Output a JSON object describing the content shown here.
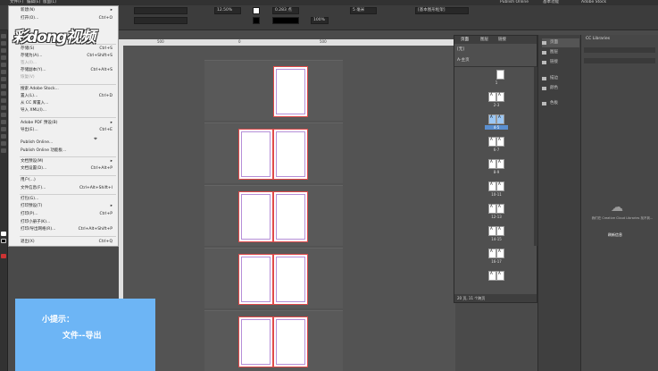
{
  "menubar": {
    "items": [
      "文件(F)",
      "编辑(E)",
      "版面(L)"
    ],
    "right": [
      "Publish Online",
      "基本功能",
      "Adobe Stock"
    ]
  },
  "control": {
    "zoom": "12.50%",
    "stroke_weight": "0.283 点",
    "opacity": "100%",
    "columns": "5 毫米",
    "style": "[基本图形框架]"
  },
  "file_menu": {
    "items": [
      {
        "label": "新建(N)",
        "shortcut": ""
      },
      {
        "label": "打开(O)...",
        "shortcut": "Ctrl+O"
      },
      {
        "label": "存储(S)",
        "shortcut": "Ctrl+S"
      },
      {
        "label": "存储为(A)...",
        "shortcut": "Ctrl+Shift+S"
      },
      {
        "label": "签入(I)...",
        "shortcut": ""
      },
      {
        "label": "存储副本(Y)...",
        "shortcut": "Ctrl+Alt+S"
      },
      {
        "label": "恢复(V)",
        "shortcut": ""
      },
      {
        "label": "搜索 Adobe Stock...",
        "shortcut": ""
      },
      {
        "label": "置入(L)...",
        "shortcut": "Ctrl+D"
      },
      {
        "label": "从 CC 库置入...",
        "shortcut": ""
      },
      {
        "label": "导入 XML(I)...",
        "shortcut": ""
      },
      {
        "label": "Adobe PDF 预设(B)",
        "shortcut": ""
      },
      {
        "label": "导出(E)...",
        "shortcut": "Ctrl+E"
      },
      {
        "label": "Publish Online...",
        "shortcut": ""
      },
      {
        "label": "Publish Online 功能板...",
        "shortcut": ""
      },
      {
        "label": "文档预设(M)",
        "shortcut": ""
      },
      {
        "label": "文档设置(D)...",
        "shortcut": "Ctrl+Alt+P"
      },
      {
        "label": "用户(...)",
        "shortcut": ""
      },
      {
        "label": "文件信息(F)...",
        "shortcut": "Ctrl+Alt+Shift+I"
      },
      {
        "label": "打包(G)...",
        "shortcut": ""
      },
      {
        "label": "打印预设(T)",
        "shortcut": ""
      },
      {
        "label": "打印(P)...",
        "shortcut": "Ctrl+P"
      },
      {
        "label": "打印小册子(K)...",
        "shortcut": ""
      },
      {
        "label": "打印/导出网格(R)...",
        "shortcut": "Ctrl+Alt+Shift+P"
      },
      {
        "label": "退出(X)",
        "shortcut": "Ctrl+Q"
      }
    ]
  },
  "logo": "彩dong视频",
  "tip": {
    "title": "小提示：",
    "body": "文件--导出"
  },
  "pages_panel": {
    "tabs": [
      "页面",
      "图层",
      "链接"
    ],
    "none": "[无]",
    "master": "A-主页",
    "groups": [
      "1",
      "2-3",
      "4-5",
      "6-7",
      "8-9",
      "10-11",
      "12-13",
      "14-15",
      "16-17"
    ],
    "footer": "20 页, 11 个跨页"
  },
  "dock": [
    "页面",
    "图层",
    "链接",
    "描边",
    "颜色",
    "色板"
  ],
  "cc": {
    "title": "CC Libraries",
    "msg": "我们在 Creative Cloud Libraries 找不到...",
    "btn": "刷新信息"
  },
  "ruler": [
    "500",
    "0",
    "500"
  ]
}
